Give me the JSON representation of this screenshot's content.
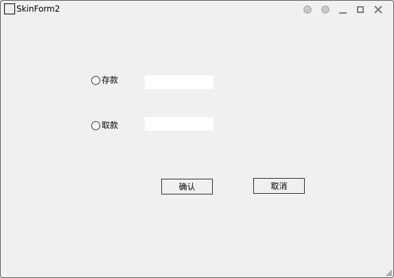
{
  "window": {
    "title": "SkinForm2",
    "controls": {
      "skin1_icon": "ring-icon",
      "skin2_icon": "ring-icon",
      "minimize_icon": "minimize-icon",
      "maximize_icon": "maximize-icon",
      "close_icon": "close-icon",
      "close_glyph": "✕"
    }
  },
  "form": {
    "deposit": {
      "label": "存款",
      "value": ""
    },
    "withdraw": {
      "label": "取款",
      "value": ""
    },
    "confirm_label": "确认",
    "cancel_label": "取消"
  },
  "colors": {
    "background": "#f0f0f0",
    "input_bg": "#ffffff",
    "control_grey": "#b8b8b8"
  }
}
